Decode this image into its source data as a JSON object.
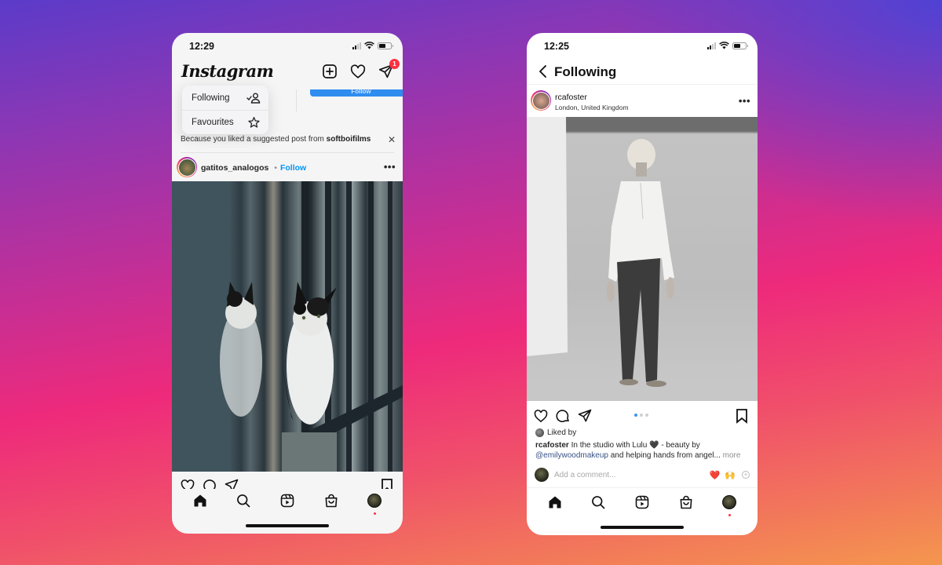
{
  "left_phone": {
    "status_time": "12:29",
    "app_title": "Instagram",
    "notification_count": "1",
    "behind_follow_label": "Follow",
    "dropdown": {
      "items": [
        {
          "label": "Following",
          "icon": "following-icon"
        },
        {
          "label": "Favourites",
          "icon": "star-icon"
        }
      ]
    },
    "suggestion": {
      "prefix": "Because you liked a suggested post from ",
      "account": "softboifilms"
    },
    "post": {
      "username": "gatitos_analogos",
      "separator": "•",
      "follow_label": "Follow",
      "more": "•••",
      "image_alt": "Two calico cats sitting on a ledge behind metal railings"
    },
    "tabbar": [
      "home-icon",
      "search-icon",
      "reels-icon",
      "shop-icon",
      "profile-avatar"
    ]
  },
  "right_phone": {
    "status_time": "12:25",
    "nav_title": "Following",
    "post": {
      "username": "rcafoster",
      "location": "London, United Kingdom",
      "more": "•••",
      "image_alt": "Black and white photo of a woman in white shirt and dark jeans standing in a studio",
      "carousel_count": 3,
      "carousel_active_index": 0,
      "liked_by_label": "Liked by",
      "caption_user": "rcafoster",
      "caption_text_1": " In the studio with Lulu 🖤 - beauty by ",
      "caption_mention": "@emilywoodmakeup",
      "caption_text_2": " and helping hands from angel...",
      "caption_more": " more",
      "comment_placeholder": "Add a comment...",
      "quick_emojis": [
        "❤️",
        "🙌"
      ]
    },
    "tabbar": [
      "home-icon",
      "search-icon",
      "reels-icon",
      "shop-icon",
      "profile-avatar"
    ]
  },
  "colors": {
    "link_blue": "#0095f6",
    "notification_red": "#ff3040",
    "mention_blue": "#385185"
  }
}
